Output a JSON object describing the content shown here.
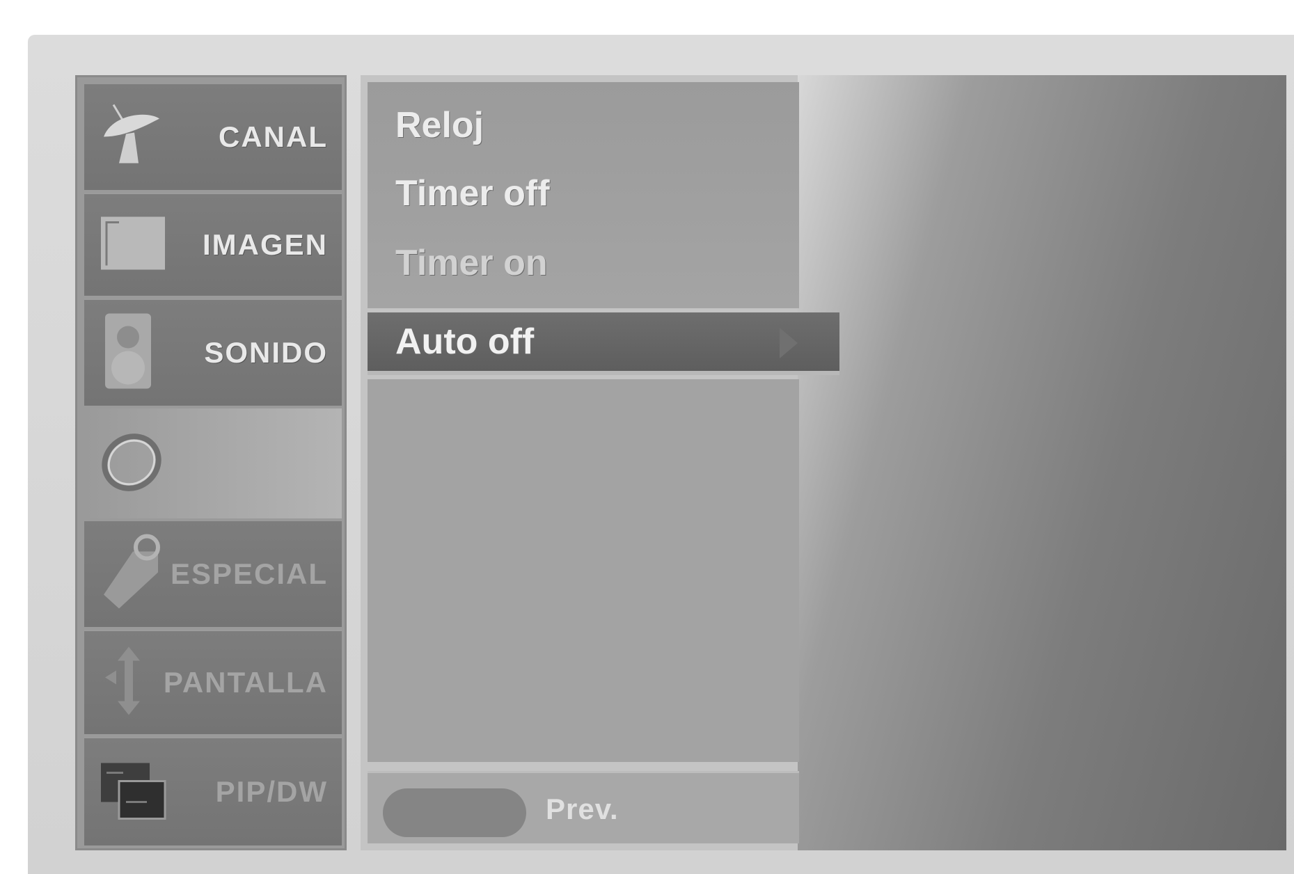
{
  "sidebar": {
    "items": [
      {
        "label": "CANAL",
        "icon": "satellite-dish-icon",
        "state": "normal"
      },
      {
        "label": "IMAGEN",
        "icon": "picture-frame-icon",
        "state": "normal"
      },
      {
        "label": "SONIDO",
        "icon": "speaker-icon",
        "state": "normal"
      },
      {
        "label": "",
        "icon": "clock-icon",
        "state": "active"
      },
      {
        "label": "ESPECIAL",
        "icon": "tag-icon",
        "state": "dim"
      },
      {
        "label": "PANTALLA",
        "icon": "arrows-icon",
        "state": "dim"
      },
      {
        "label": "PIP/DW",
        "icon": "pip-icon",
        "state": "dim"
      }
    ]
  },
  "submenu": {
    "items": [
      {
        "label": "Reloj"
      },
      {
        "label": "Timer off"
      },
      {
        "label": "Timer on"
      }
    ],
    "selected": {
      "label": "Auto off"
    }
  },
  "footer": {
    "prev_label": "Prev."
  }
}
